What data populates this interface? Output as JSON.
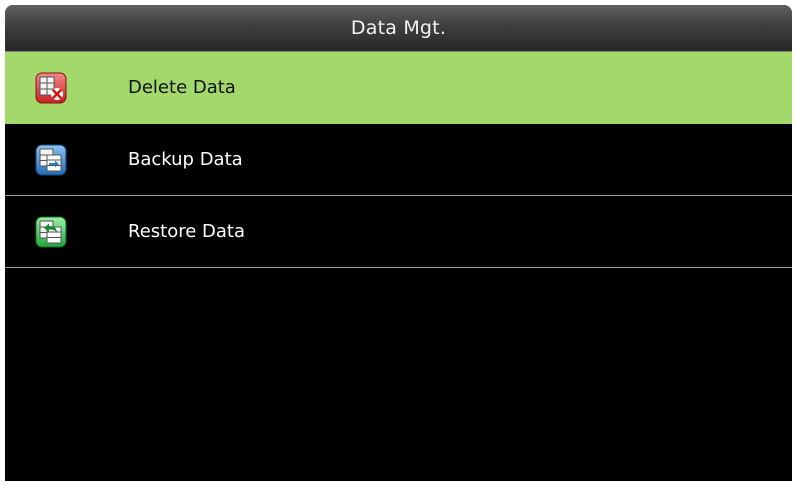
{
  "title": "Data Mgt.",
  "colors": {
    "background": "#000000",
    "selected_row": "#a3d96a",
    "divider": "#9a9a9a"
  },
  "menu": {
    "items": [
      {
        "label": "Delete Data",
        "icon": "delete-data-icon",
        "selected": true
      },
      {
        "label": "Backup Data",
        "icon": "backup-data-icon",
        "selected": false
      },
      {
        "label": "Restore Data",
        "icon": "restore-data-icon",
        "selected": false
      }
    ]
  }
}
